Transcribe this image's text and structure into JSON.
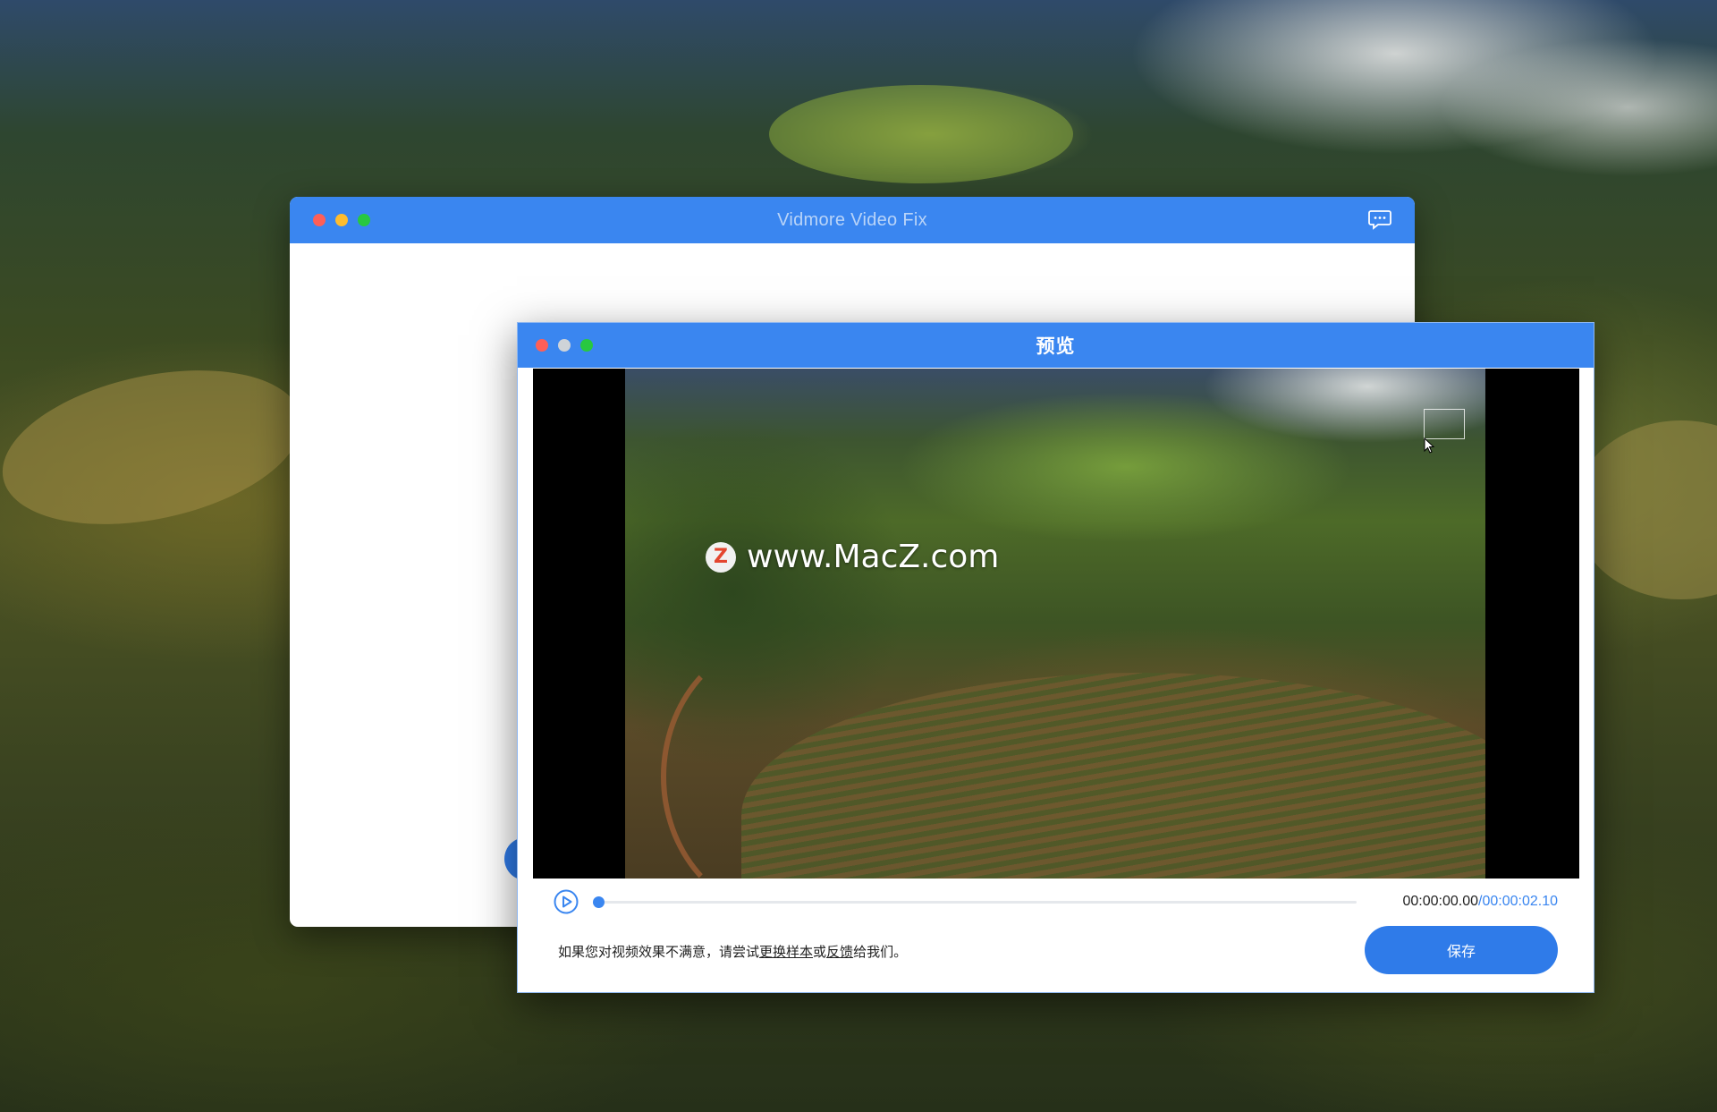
{
  "main_window": {
    "title": "Vidmore Video Fix",
    "feedback_icon": "chat-bubble-icon"
  },
  "preview_window": {
    "title": "预览",
    "watermark": {
      "logo_letter": "Z",
      "text": "www.MacZ.com"
    },
    "player": {
      "play_icon": "play-icon",
      "current_time": "00:00:00.00",
      "separator": "/",
      "total_time": "00:00:02.10",
      "progress": 0.0
    },
    "footer": {
      "note_prefix": "如果您对视频效果不满意，请尝试",
      "link_replace_sample": "更换样本",
      "note_or": "或",
      "link_feedback": "反馈",
      "note_suffix": "给我们。",
      "save_label": "保存"
    }
  },
  "colors": {
    "accent": "#3a86f0",
    "titlebar_text_inactive": "#b9d4f8",
    "close": "#fe5f57",
    "minimize": "#febc2e",
    "zoom": "#28c840"
  }
}
